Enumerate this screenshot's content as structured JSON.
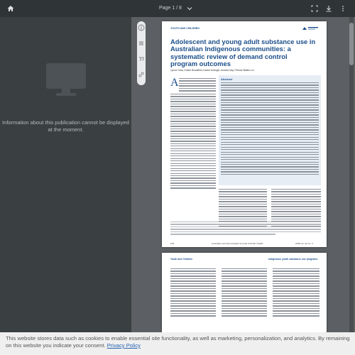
{
  "toolbar": {
    "page_indicator": "Page 1 / 8",
    "icons": [
      "home-icon",
      "fit-width-icon",
      "download-icon",
      "more-icon"
    ]
  },
  "sidebar": {
    "message": "Information about this publication cannot be displayed at the moment."
  },
  "tool_rail": {
    "icons": [
      "info-icon",
      "list-icon",
      "quote-icon",
      "link-icon"
    ]
  },
  "page1": {
    "journal_section": "YOUTH AND CHILDREN",
    "logo_text": "ANZJPH",
    "title": "Adolescent and young adult substance use in Australian Indigenous communities: a systematic review of demand control program outcomes",
    "authors": "Lynore Geia, Kristin Broadfield, Daniel Grainger, Andrew Day, Felecia Watkin-Lui",
    "abstract_heading": "Abstract",
    "dropcap": "A",
    "footer_left": "254",
    "footer_center": "Australian and New Zealand Journal of Public Health",
    "footer_right": "2018 vol. 42 no. 3"
  },
  "page2": {
    "header_left": "Youth and Children",
    "header_right": "Indigenous youth substance use programs"
  },
  "cookie": {
    "text": "This website stores data such as cookies to enable essential site functionality, as well as marketing, personalization, and analytics. By remaining on this website you indicate your consent.",
    "link": "Privacy Policy"
  }
}
